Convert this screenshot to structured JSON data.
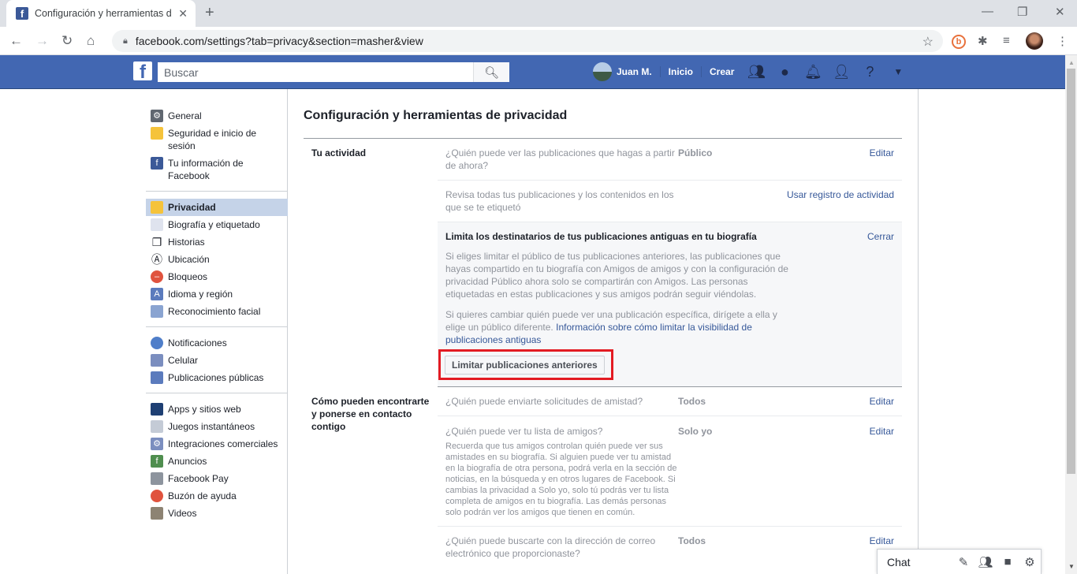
{
  "browser": {
    "tab_title": "Configuración y herramientas de",
    "url": "facebook.com/settings?tab=privacy&section=masher&view"
  },
  "fb_header": {
    "search_placeholder": "Buscar",
    "user_name": "Juan M.",
    "home_label": "Inicio",
    "create_label": "Crear"
  },
  "sidebar": {
    "groups": [
      [
        {
          "label": "General",
          "icon": "gears-icon",
          "color": "#606770"
        },
        {
          "label": "Seguridad e inicio de sesión",
          "icon": "badge-icon",
          "color": "#f5c33b"
        },
        {
          "label": "Tu información de Facebook",
          "icon": "facebook-icon",
          "color": "#3b5998"
        }
      ],
      [
        {
          "label": "Privacidad",
          "icon": "lock-icon",
          "color": "#f5c33b",
          "active": true
        },
        {
          "label": "Biografía y etiquetado",
          "icon": "timeline-icon",
          "color": "#dfe3ee"
        },
        {
          "label": "Historias",
          "icon": "book-icon",
          "color": "#1d2129"
        },
        {
          "label": "Ubicación",
          "icon": "location-icon",
          "color": "#1d2129"
        },
        {
          "label": "Bloqueos",
          "icon": "block-icon",
          "color": "#e0533e"
        },
        {
          "label": "Idioma y región",
          "icon": "language-icon",
          "color": "#5b7bbd"
        },
        {
          "label": "Reconocimiento facial",
          "icon": "face-icon",
          "color": "#8aa4d1"
        }
      ],
      [
        {
          "label": "Notificaciones",
          "icon": "globe-icon",
          "color": "#4f7ec9"
        },
        {
          "label": "Celular",
          "icon": "mobile-icon",
          "color": "#7b8ebf"
        },
        {
          "label": "Publicaciones públicas",
          "icon": "rss-icon",
          "color": "#5b7bbd"
        }
      ],
      [
        {
          "label": "Apps y sitios web",
          "icon": "apps-icon",
          "color": "#1e3f73"
        },
        {
          "label": "Juegos instantáneos",
          "icon": "gamepad-icon",
          "color": "#c4cbd6"
        },
        {
          "label": "Integraciones comerciales",
          "icon": "business-gear-icon",
          "color": "#7b8ebf"
        },
        {
          "label": "Anuncios",
          "icon": "ads-icon",
          "color": "#4f8e4f"
        },
        {
          "label": "Facebook Pay",
          "icon": "card-icon",
          "color": "#8d949e"
        },
        {
          "label": "Buzón de ayuda",
          "icon": "lifebuoy-icon",
          "color": "#e0533e"
        },
        {
          "label": "Videos",
          "icon": "film-icon",
          "color": "#8d8373"
        }
      ]
    ]
  },
  "main": {
    "title": "Configuración y herramientas de privacidad",
    "sections": [
      {
        "label": "Tu actividad",
        "rows": [
          {
            "question": "¿Quién puede ver las publicaciones que hagas a partir de ahora?",
            "value": "Público",
            "action": "Editar"
          },
          {
            "question": "Revisa todas tus publicaciones y los contenidos en los que se te etiquetó",
            "value": "",
            "action": "Usar registro de actividad"
          }
        ],
        "expanded": {
          "title": "Limita los destinatarios de tus publicaciones antiguas en tu biografía",
          "close": "Cerrar",
          "p1": "Si eliges limitar el público de tus publicaciones anteriores, las publicaciones que hayas compartido en tu biografía con Amigos de amigos y con la configuración de privacidad Público ahora solo se compartirán con Amigos. Las personas etiquetadas en estas publicaciones y sus amigos podrán seguir viéndolas.",
          "p2": "Si quieres cambiar quién puede ver una publicación específica, dirígete a ella y elige un público diferente.",
          "p2_link": "Información sobre cómo limitar la visibilidad de publicaciones antiguas",
          "button": "Limitar publicaciones anteriores"
        }
      },
      {
        "label": "Cómo pueden encontrarte y ponerse en contacto contigo",
        "rows": [
          {
            "question": "¿Quién puede enviarte solicitudes de amistad?",
            "value": "Todos",
            "action": "Editar"
          },
          {
            "question": "¿Quién puede ver tu lista de amigos?",
            "value": "Solo yo",
            "action": "Editar",
            "description": "Recuerda que tus amigos controlan quién puede ver sus amistades en su biografía. Si alguien puede ver tu amistad en la biografía de otra persona, podrá verla en la sección de noticias, en la búsqueda y en otros lugares de Facebook. Si cambias la privacidad a Solo yo, solo tú podrás ver tu lista completa de amigos en tu biografía. Las demás personas solo podrán ver los amigos que tienen en común."
          },
          {
            "question": "¿Quién puede buscarte con la dirección de correo electrónico que proporcionaste?",
            "value": "Todos",
            "action": "Editar"
          }
        ]
      }
    ]
  },
  "chat": {
    "label": "Chat"
  }
}
